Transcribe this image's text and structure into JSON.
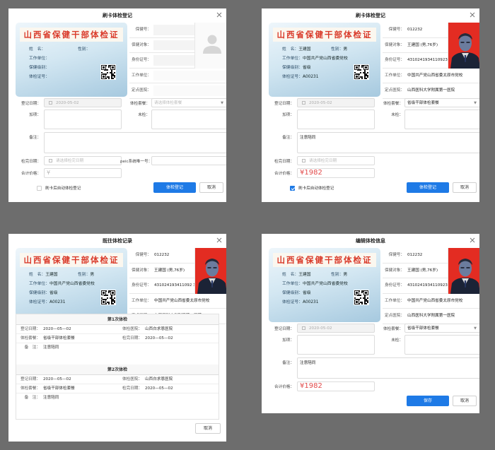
{
  "card": {
    "title": "山西省保健干部体检证",
    "name_label": "姓　名：",
    "gender_label": "性别：",
    "work_label": "工作单位：",
    "level_label": "保健级别：",
    "cert_label": "体检证号：",
    "name": "王建国",
    "gender": "男",
    "work_unit": "中国共产党山西省委党校",
    "level": "省级",
    "cert_no": "A00231"
  },
  "info": {
    "health_no_label": "保健号：",
    "health_obj_label": "保健对象：",
    "id_label": "身份证号：",
    "work_label": "工作单位：",
    "hospital_label": "定点医院：",
    "health_no": "012232",
    "health_obj": "王建国 (男,76岁)",
    "id_no": "4310241934110923 2x",
    "id_no_full": "431024193411092 32x",
    "work_unit_long": "中国共产党山西省委太原市党校",
    "hospital": "山西医科大学附属第一医院"
  },
  "dlg1": {
    "title": "刷卡体检登记",
    "reg_date_label": "登记日期：",
    "reg_date": "2020-05-02",
    "package_label": "体检套餐：",
    "package_placeholder": "请选择体检套餐",
    "add_label": "加项：",
    "remove_label": "未检：",
    "remark_label": "备注：",
    "check_date_label": "检完日期：",
    "check_date_placeholder": "请选择检完日期",
    "peic_label": "peic系统唯一号：",
    "total_label": "合计价格：",
    "price_placeholder": "¥",
    "auto_label": "刷卡后自动体检登记",
    "submit": "体检登记",
    "cancel": "取消"
  },
  "dlg2": {
    "title": "刷卡体检登记",
    "reg_date_label": "登记日期：",
    "reg_date": "2020-05-02",
    "package_label": "体检套餐：",
    "package": "省级干部体检套餐",
    "add_label": "加项：",
    "remove_label": "未检：",
    "remark_label": "备注：",
    "remark": "注意陪同",
    "check_date_label": "检完日期：",
    "check_date_placeholder": "请选择检完日期",
    "total_label": "合计价格：",
    "price": "¥1982",
    "auto_label": "刷卡后自动体检登记",
    "submit": "体检登记",
    "cancel": "取消"
  },
  "dlg3": {
    "title": "既往体检记录",
    "cancel": "取消",
    "records": [
      {
        "heading": "第1次体检",
        "reg_date_label": "登记日期：",
        "reg_date": "2020—05—02",
        "hospital_label": "体检医院：",
        "hospital": "山西白求恩医院",
        "package_label": "体检套餐：",
        "package": "省级干部体检套餐",
        "check_date_label": "检完日期：",
        "check_date": "2020—05—02",
        "remark_label": "备　注：",
        "remark": "注意陪同"
      },
      {
        "heading": "第2次体检",
        "reg_date_label": "登记日期：",
        "reg_date": "2020—05—02",
        "hospital_label": "体检医院：",
        "hospital": "山西白求恩医院",
        "package_label": "体检套餐：",
        "package": "省级干部体检套餐",
        "check_date_label": "检完日期：",
        "check_date": "2020—05—02",
        "remark_label": "备　注：",
        "remark": "注意陪同"
      }
    ]
  },
  "dlg4": {
    "title": "编辑体检信息",
    "reg_date_label": "登记日期：",
    "reg_date": "2020-05-02",
    "package_label": "体检套餐：",
    "package": "省级干部体检套餐",
    "add_label": "加项：",
    "remove_label": "未检：",
    "remark_label": "备注：",
    "remark": "注意陪同",
    "total_label": "合计价格：",
    "price": "¥1982",
    "save": "保存",
    "cancel": "取消"
  },
  "colors": {
    "primary": "#1e7ae6",
    "price": "#e24b4b",
    "card_title": "#d93a2a"
  }
}
